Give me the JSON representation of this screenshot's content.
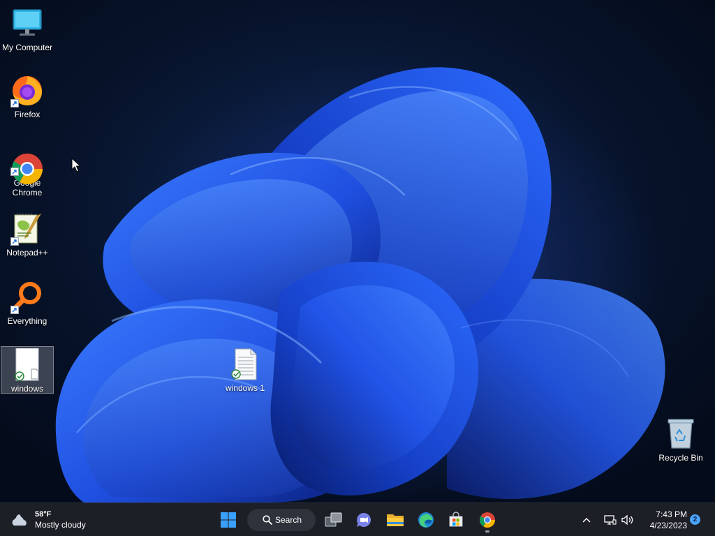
{
  "desktop": {
    "icons": [
      {
        "label": "My Computer"
      },
      {
        "label": "Firefox"
      },
      {
        "label": "Google\nChrome"
      },
      {
        "label": "Notepad++"
      },
      {
        "label": "Everything"
      },
      {
        "label": "windows"
      },
      {
        "label": "windows 1"
      },
      {
        "label": "Recycle Bin"
      }
    ]
  },
  "taskbar": {
    "weather": {
      "temp": "58°F",
      "condition": "Mostly cloudy",
      "icon": "partly-cloudy-icon"
    },
    "search_label": "Search",
    "pinned": [
      {
        "name": "start-icon"
      },
      {
        "name": "task-view-icon"
      },
      {
        "name": "teams-chat-icon"
      },
      {
        "name": "file-explorer-icon"
      },
      {
        "name": "edge-icon"
      },
      {
        "name": "microsoft-store-icon"
      },
      {
        "name": "chrome-icon"
      }
    ],
    "tray": {
      "time": "7:43 PM",
      "date": "4/23/2023",
      "notification_count": "2"
    }
  },
  "colors": {
    "taskbar_bg": "#1c1f26",
    "accent_blue": "#4aa3ff",
    "wallpaper_blue": "#1f5cff"
  }
}
